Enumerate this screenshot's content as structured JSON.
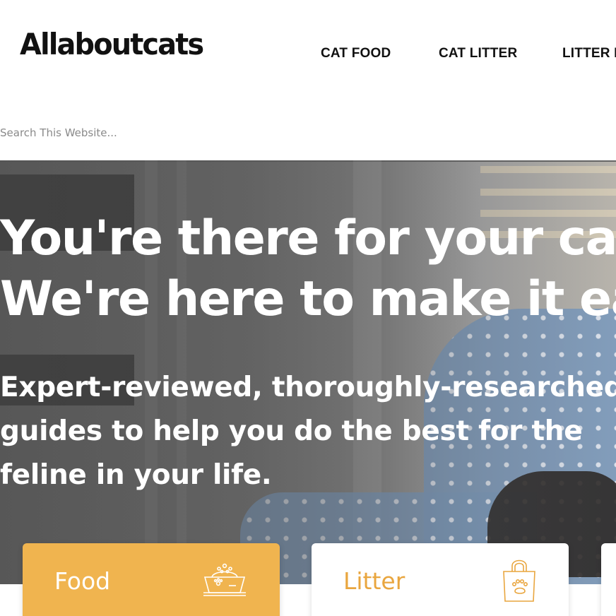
{
  "header": {
    "logo": "Allaboutcats",
    "nav": [
      "CAT FOOD",
      "CAT LITTER",
      "LITTER BOXES"
    ]
  },
  "search": {
    "placeholder": "Search This Website..."
  },
  "hero": {
    "title_line1": "You're there for your cat.",
    "title_line2": "We're here to make it easier.",
    "subtitle": "Expert-reviewed, thoroughly-researched guides to help you do the best for the feline in your life."
  },
  "categories": [
    {
      "label": "Food",
      "icon": "food-bowl-icon",
      "bg": "#f0b44f",
      "text_color": "#ffffff"
    },
    {
      "label": "Litter",
      "icon": "litter-bag-icon",
      "bg": "#ffffff",
      "text_color": "#e9a63f"
    }
  ],
  "colors": {
    "accent": "#f0b44f",
    "text_dark": "#111111",
    "white": "#ffffff"
  }
}
